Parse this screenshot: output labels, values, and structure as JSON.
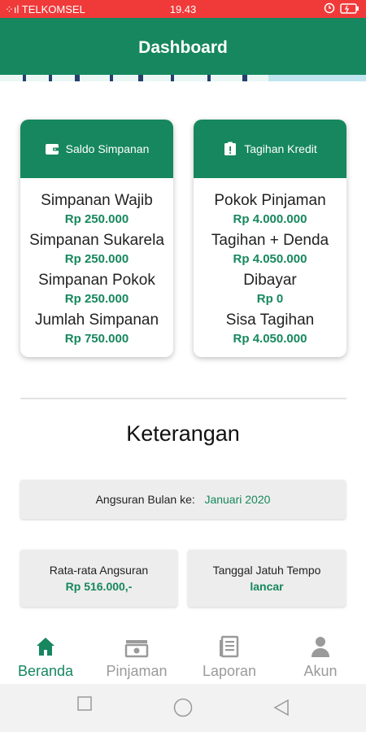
{
  "status_bar": {
    "carrier": "⁘ıl TELKOMSEL",
    "time": "19.43"
  },
  "app_bar": {
    "title": "Dashboard"
  },
  "cards": {
    "savings": {
      "title": "Saldo Simpanan",
      "rows": [
        {
          "label": "Simpanan Wajib",
          "value": "Rp 250.000"
        },
        {
          "label": "Simpanan Sukarela",
          "value": "Rp 250.000"
        },
        {
          "label": "Simpanan Pokok",
          "value": "Rp 250.000"
        },
        {
          "label": "Jumlah Simpanan",
          "value": "Rp 750.000"
        }
      ]
    },
    "credit": {
      "title": "Tagihan Kredit",
      "rows": [
        {
          "label": "Pokok Pinjaman",
          "value": "Rp 4.000.000"
        },
        {
          "label": "Tagihan + Denda",
          "value": "Rp 4.050.000"
        },
        {
          "label": "Dibayar",
          "value": "Rp 0"
        },
        {
          "label": "Sisa Tagihan",
          "value": "Rp 4.050.000"
        }
      ]
    }
  },
  "info": {
    "title": "Keterangan",
    "installment_month_label": "Angsuran Bulan ke:",
    "installment_month_value": "Januari 2020",
    "avg_installment_label": "Rata-rata Angsuran",
    "avg_installment_value": "Rp 516.000,-",
    "due_date_label": "Tanggal Jatuh Tempo",
    "due_date_value": "lancar"
  },
  "bottom_nav": [
    {
      "label": "Beranda",
      "icon": "home-icon",
      "active": true
    },
    {
      "label": "Pinjaman",
      "icon": "money-icon",
      "active": false
    },
    {
      "label": "Laporan",
      "icon": "report-icon",
      "active": false
    },
    {
      "label": "Akun",
      "icon": "person-icon",
      "active": false
    }
  ],
  "colors": {
    "primary": "#16875e",
    "status_bar": "#f03a3a",
    "inactive": "#9a9a9a"
  }
}
